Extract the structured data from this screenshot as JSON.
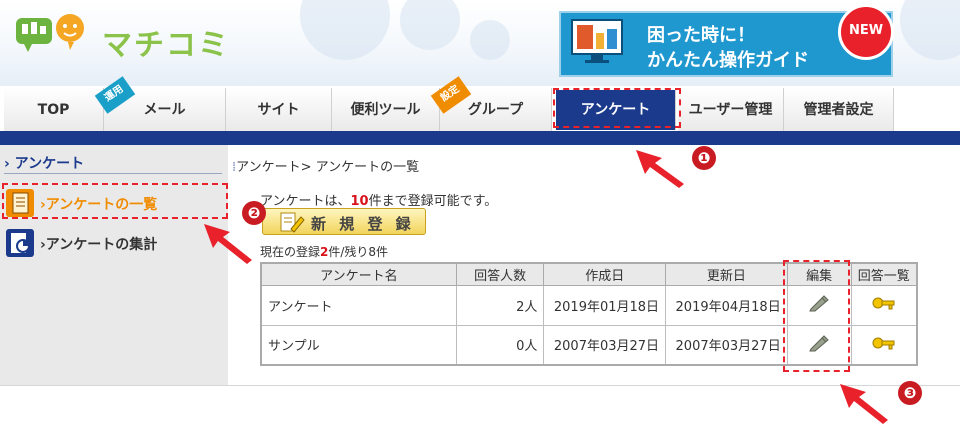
{
  "header": {
    "logo_text": "マチコミ",
    "banner": {
      "line1": "困った時に！",
      "line2": "かんたん操作ガイド",
      "badge": "NEW"
    }
  },
  "tabs": [
    {
      "label": "TOP"
    },
    {
      "label": "メール",
      "ribbon": "運用"
    },
    {
      "label": "サイト"
    },
    {
      "label": "便利ツール"
    },
    {
      "label": "グループ",
      "ribbon": "設定"
    },
    {
      "label": "アンケート",
      "active": true
    },
    {
      "label": "ユーザー管理"
    },
    {
      "label": "管理者設定"
    }
  ],
  "sidebar": {
    "heading": "アンケート",
    "items": [
      {
        "label": "アンケートの一覧",
        "icon": "document-list-icon",
        "active": true
      },
      {
        "label": "アンケートの集計",
        "icon": "chart-report-icon"
      }
    ]
  },
  "main": {
    "breadcrumb": "アンケート> アンケートの一覧",
    "info_prefix": "アンケートは、",
    "info_num": "10",
    "info_suffix": "件まで登録可能です。",
    "new_button": "新 規 登 録",
    "status_prefix": "現在の登録",
    "status_num": "2",
    "status_suffix": "件/残り8件",
    "columns": [
      "アンケート名",
      "回答人数",
      "作成日",
      "更新日",
      "編集",
      "回答一覧"
    ],
    "rows": [
      {
        "name": "アンケート",
        "respondents": "2人",
        "created": "2019年01月18日",
        "updated": "2019年04月18日"
      },
      {
        "name": "サンプル",
        "respondents": "0人",
        "created": "2007年03月27日",
        "updated": "2007年03月27日"
      }
    ]
  },
  "markers": [
    "❶",
    "❷",
    "❸"
  ],
  "colors": {
    "nav_blue": "#1b3a8c",
    "highlight_red": "#e8212b",
    "active_orange": "#f08c00"
  }
}
